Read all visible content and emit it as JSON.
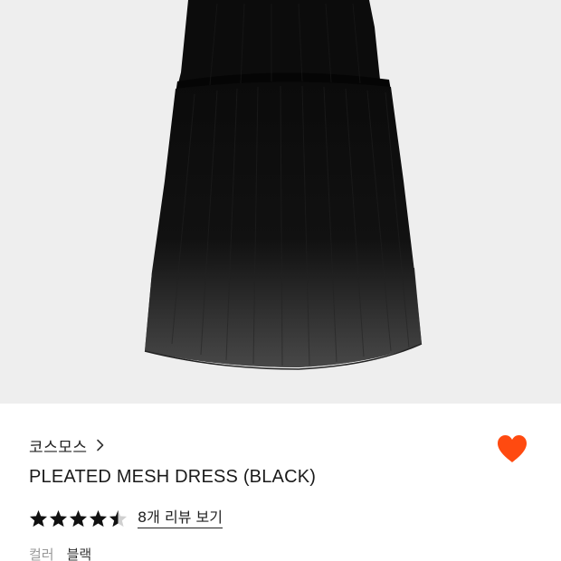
{
  "product": {
    "brand": "코스모스",
    "title": "PLEATED MESH DRESS (BLACK)",
    "rating": 4.5,
    "review_link": "8개 리뷰 보기",
    "color_label": "컬러",
    "color_value": "블랙"
  },
  "icons": {
    "brand_chevron": "chevron-right-icon",
    "wishlist": "heart-icon",
    "rating": "star-icon"
  },
  "colors": {
    "wishlist_heart": "#ff4a10",
    "star": "#111111",
    "image_background": "#eeeeee",
    "dress": "#0d0d0d"
  }
}
